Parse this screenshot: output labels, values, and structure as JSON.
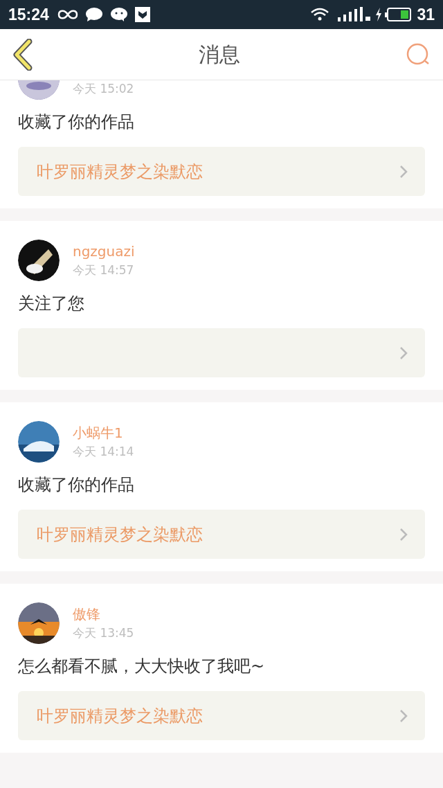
{
  "status_bar": {
    "time": "15:24",
    "battery": "31"
  },
  "header": {
    "title": "消息"
  },
  "messages": [
    {
      "time": "今天 15:02",
      "text": "收藏了你的作品",
      "link": "叶罗丽精灵梦之染默恋"
    },
    {
      "name": "ngzguazi",
      "time": "今天 14:57",
      "text": "关注了您"
    },
    {
      "name": "小蜗牛1",
      "time": "今天 14:14",
      "text": "收藏了你的作品",
      "link": "叶罗丽精灵梦之染默恋"
    },
    {
      "name": "傲锋",
      "time": "今天 13:45",
      "text": "怎么都看不腻，大大快收了我吧~",
      "link": "叶罗丽精灵梦之染默恋"
    }
  ]
}
